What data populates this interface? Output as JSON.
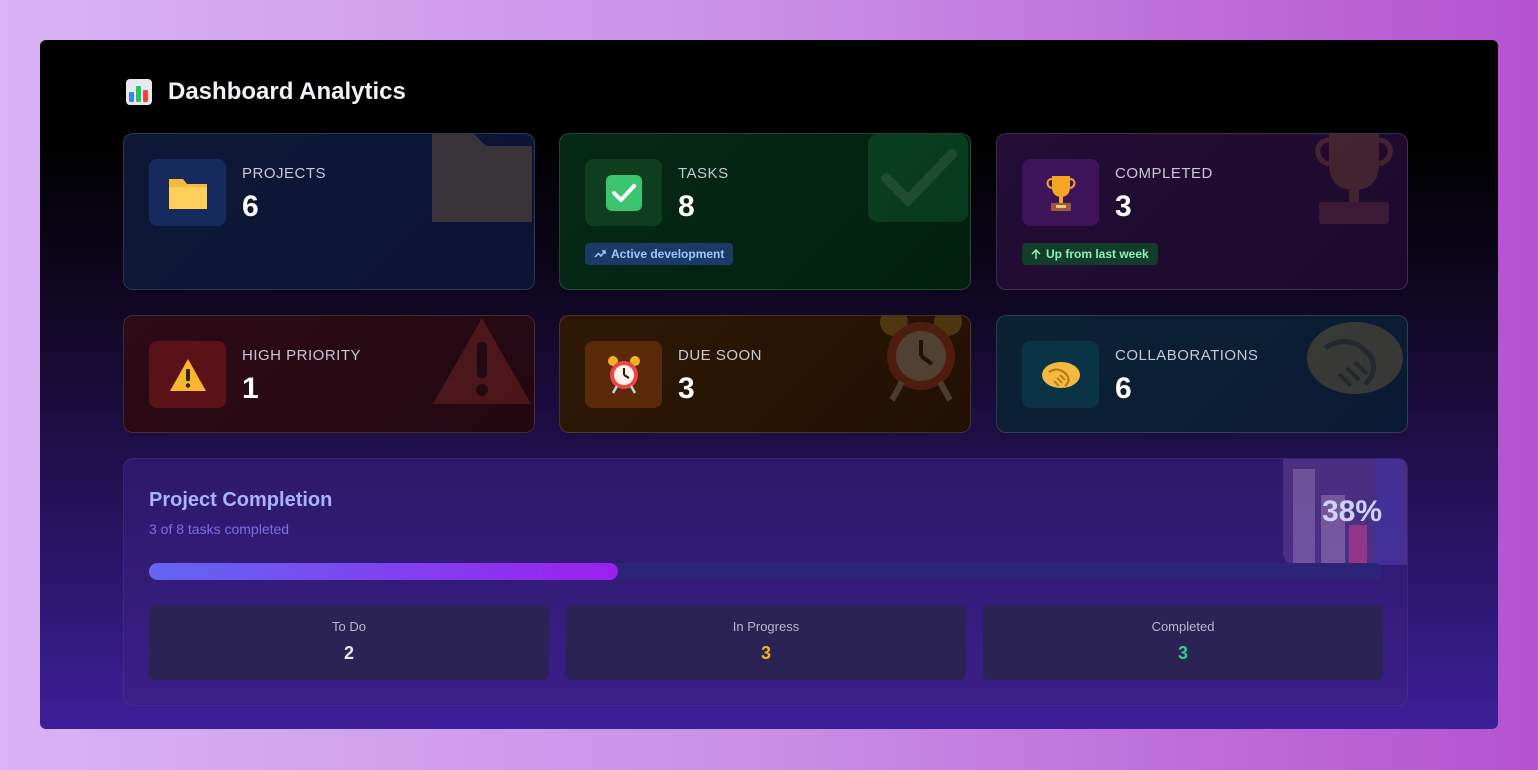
{
  "header": {
    "title": "Dashboard Analytics",
    "icon": "bar-chart-icon"
  },
  "cards": {
    "projects": {
      "label": "PROJECTS",
      "value": "6",
      "icon": "folder-icon"
    },
    "tasks": {
      "label": "TASKS",
      "value": "8",
      "icon": "check-box-icon",
      "badge": "Active development",
      "badge_icon": "trend-up-icon"
    },
    "completed": {
      "label": "COMPLETED",
      "value": "3",
      "icon": "trophy-icon",
      "badge": "Up from last week",
      "badge_icon": "arrow-up-icon"
    },
    "high_priority": {
      "label": "HIGH PRIORITY",
      "value": "1",
      "icon": "warning-icon"
    },
    "due_soon": {
      "label": "DUE SOON",
      "value": "3",
      "icon": "alarm-clock-icon"
    },
    "collaborations": {
      "label": "COLLABORATIONS",
      "value": "6",
      "icon": "handshake-icon"
    }
  },
  "progress": {
    "title": "Project Completion",
    "subtitle": "3 of 8 tasks completed",
    "percent_label": "38%",
    "fraction": 0.38,
    "stats": [
      {
        "label": "To Do",
        "value": "2",
        "color": "#e8e8f0"
      },
      {
        "label": "In Progress",
        "value": "3",
        "color": "#f5b21b"
      },
      {
        "label": "Completed",
        "value": "3",
        "color": "#2ecf8f"
      }
    ]
  },
  "colors": {
    "accent": "#6366f1",
    "accent_end": "#9b20ee",
    "tasks_badge_bg": "#1b3a66",
    "tasks_badge_text": "#9cc6ff",
    "completed_badge_bg": "#123d2a",
    "completed_badge_text": "#8ff0b8"
  }
}
